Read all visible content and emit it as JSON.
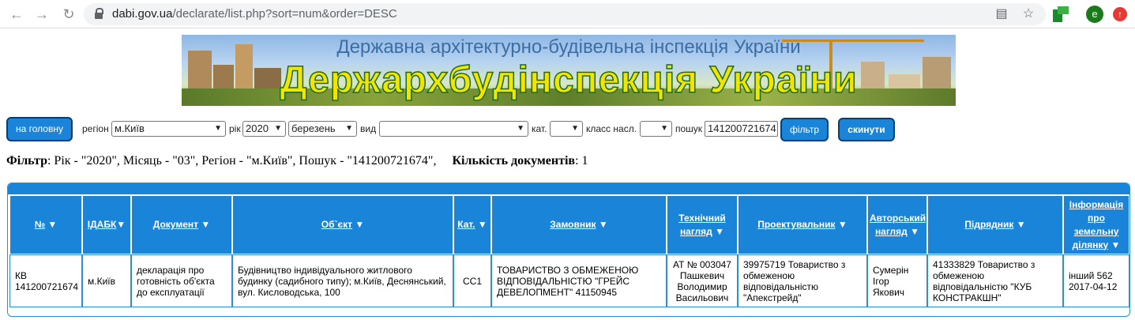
{
  "browser": {
    "url_host": "dabi.gov.ua",
    "url_path": "/declarate/list.php?sort=num&order=DESC",
    "avatar_letter": "e"
  },
  "banner": {
    "subtitle": "Державна архітектурно-будівельна інспекція України",
    "title": "Держархбудінспекція України"
  },
  "filters": {
    "home_button": "на головну",
    "region_label": "регіон",
    "region_value": "м.Київ",
    "year_label": "рік",
    "year_value": "2020",
    "month_value": "березень",
    "type_label": "вид",
    "type_value": "",
    "category_label": "кат.",
    "category_value": "",
    "class_label": "класс насл.",
    "class_value": "",
    "search_label": "пошук",
    "search_value": "141200721674",
    "filter_button": "фільтр",
    "reset_button": "скинути"
  },
  "summary": {
    "filter_label": "Фільтр",
    "filter_text": ": Рік - \"2020\", Місяць - \"03\", Регіон - \"м.Київ\", Пошук - \"141200721674\",",
    "count_label": "Кількість документів",
    "count_value": ": 1"
  },
  "table": {
    "headers": [
      "№",
      "ІДАБК",
      "Документ",
      "Об`єкт",
      "Кат.",
      "Замовник",
      "Технічний нагляд",
      "Проектувальник",
      "Авторський нагляд",
      "Підрядник",
      "Інформація про земельну ділянку"
    ],
    "rows": [
      [
        "КВ 141200721674",
        "м.Київ",
        "декларація про готовність об'єкта до експлуатації",
        "Будівництво індивідуального житлового будинку (садибного типу); м.Київ, Деснянський, вул. Кисловодська, 100",
        "СС1",
        "ТОВАРИСТВО З ОБМЕЖЕНОЮ ВІДПОВІДАЛЬНІСТЮ \"ГРЕЙС ДЕВЕЛОПМЕНТ\" 41150945",
        "АТ № 003047 Пашкевич Володимир Васильович",
        "39975719 Товариство з обмеженою відповідальністю \"Апекстрейд\"",
        "Сумерін Ігор Якович",
        "41333829 Товариство з обмеженою відповідальністю \"КУБ КОНСТРАКШН\"",
        "інший 562 2017-04-12"
      ]
    ]
  }
}
